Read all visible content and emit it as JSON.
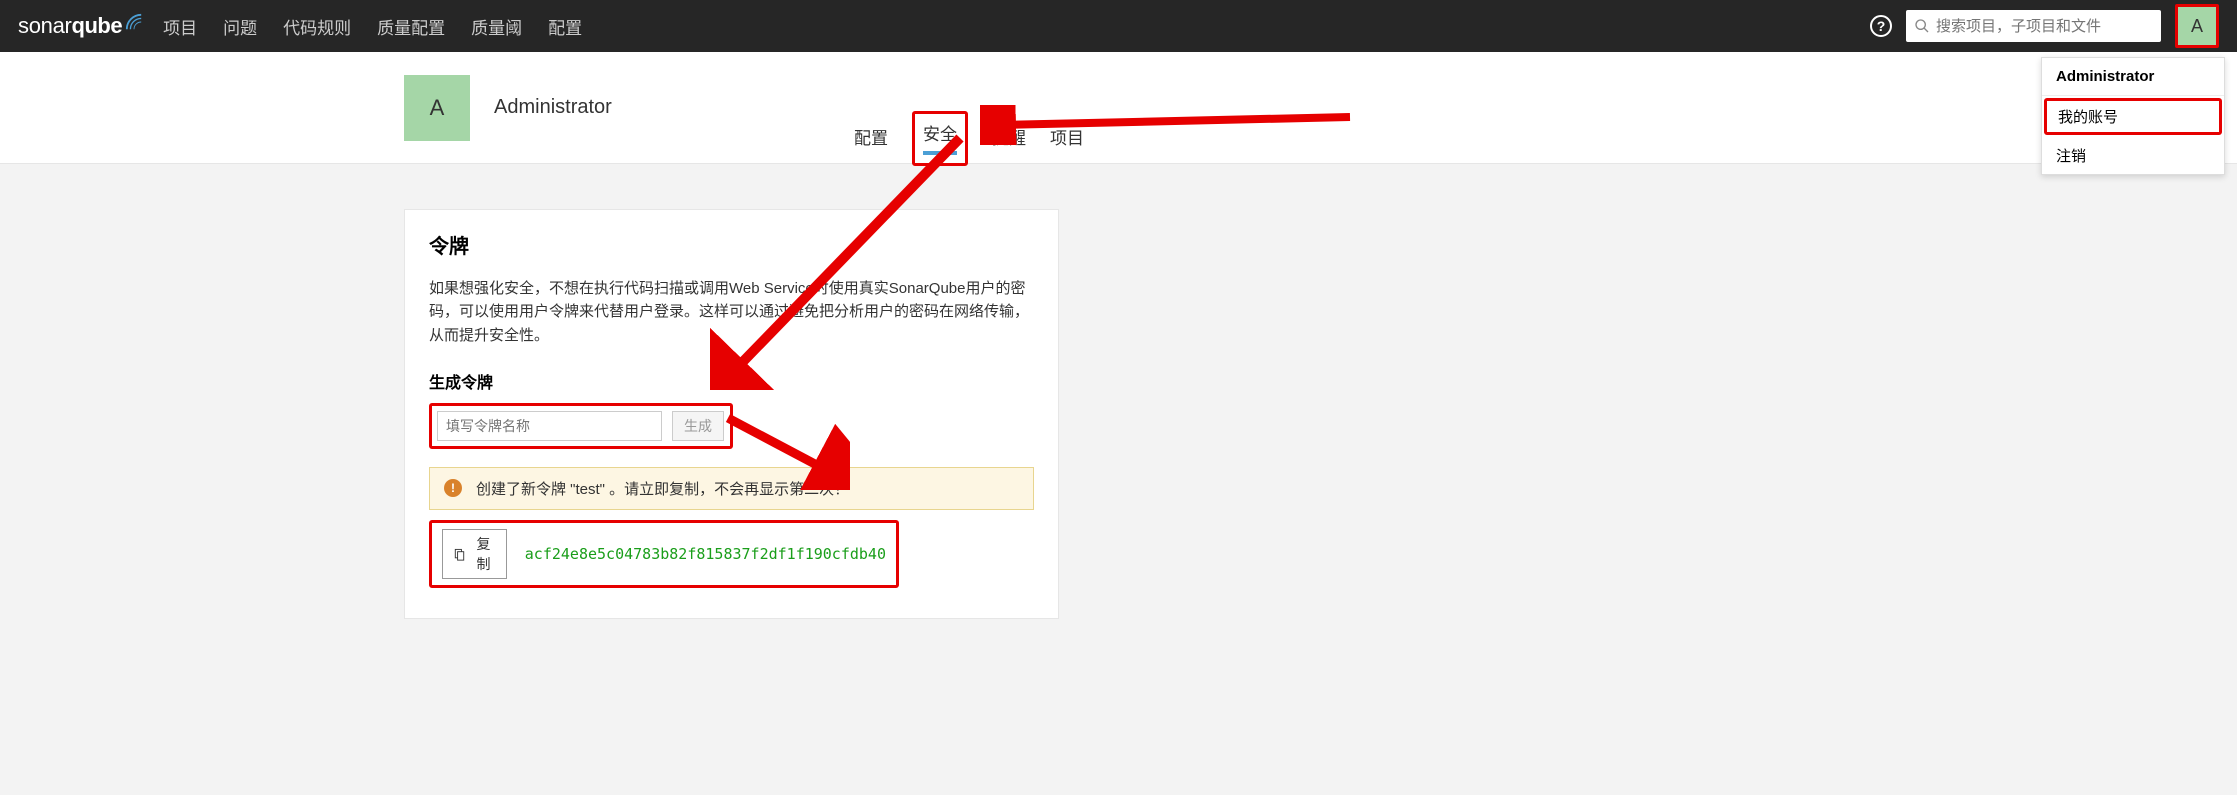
{
  "logo": {
    "sonar": "sonar",
    "qube": "qube"
  },
  "nav": [
    "项目",
    "问题",
    "代码规则",
    "质量配置",
    "质量阈",
    "配置"
  ],
  "search": {
    "placeholder": "搜索项目，子项目和文件"
  },
  "avatar_letter": "A",
  "dropdown": {
    "header": "Administrator",
    "my_account": "我的账号",
    "logout": "注销"
  },
  "user": {
    "avatar": "A",
    "name": "Administrator"
  },
  "sub_tabs": {
    "config": "配置",
    "security": "安全",
    "notify": "提醒",
    "projects": "项目"
  },
  "panel": {
    "title": "令牌",
    "desc": "如果想强化安全，不想在执行代码扫描或调用Web Service时使用真实SonarQube用户的密码，可以使用用户令牌来代替用户登录。这样可以通过避免把分析用户的密码在网络传输，从而提升安全性。",
    "gen_title": "生成令牌",
    "input_placeholder": "填写令牌名称",
    "gen_btn": "生成"
  },
  "alert": {
    "msg": "创建了新令牌 \"test\" 。请立即复制，不会再显示第二次！"
  },
  "token": {
    "copy": "复制",
    "value": "acf24e8e5c04783b82f815837f2df1f190cfdb40"
  }
}
